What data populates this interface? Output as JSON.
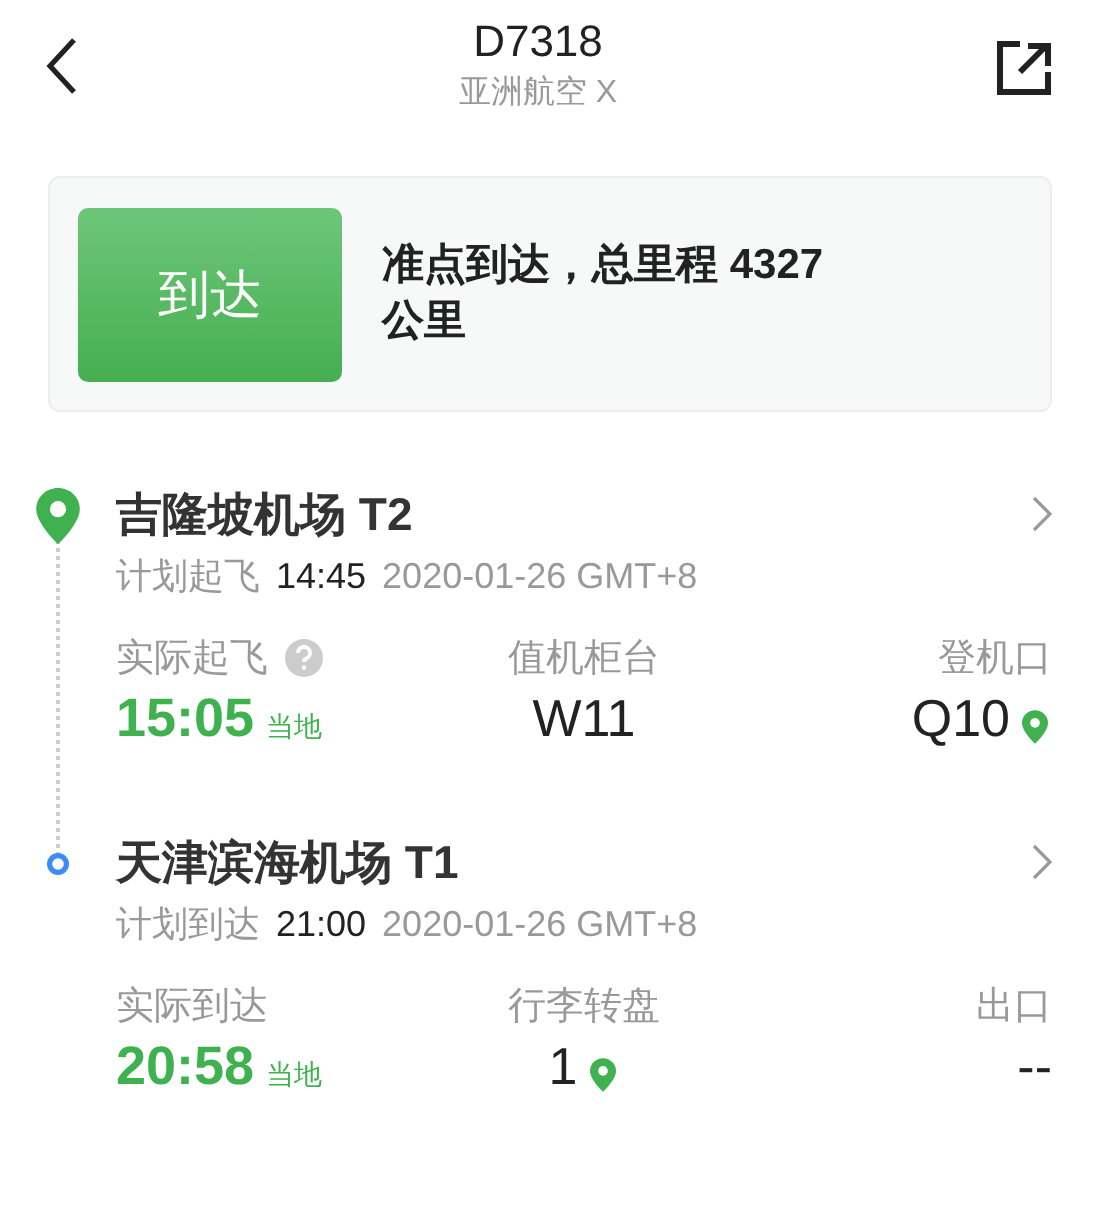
{
  "header": {
    "title": "D7318",
    "subtitle": "亚洲航空 X"
  },
  "status": {
    "badge": "到达",
    "text": "准点到达，总里程 4327 公里"
  },
  "segments": [
    {
      "kind": "departure",
      "airport": "吉隆坡机场 T2",
      "scheduled_label": "计划起飞",
      "scheduled_time": "14:45",
      "scheduled_date": "2020-01-26 GMT+8",
      "actual_label": "实际起飞",
      "help": true,
      "actual_time": "15:05",
      "local_label": "当地",
      "middle_label": "值机柜台",
      "middle_value": "W11",
      "middle_pin": false,
      "right_label": "登机口",
      "right_value": "Q10",
      "right_pin": true
    },
    {
      "kind": "arrival",
      "airport": "天津滨海机场 T1",
      "scheduled_label": "计划到达",
      "scheduled_time": "21:00",
      "scheduled_date": "2020-01-26 GMT+8",
      "actual_label": "实际到达",
      "help": false,
      "actual_time": "20:58",
      "local_label": "当地",
      "middle_label": "行李转盘",
      "middle_value": "1",
      "middle_pin": true,
      "right_label": "出口",
      "right_value": "--",
      "right_pin": false
    }
  ]
}
